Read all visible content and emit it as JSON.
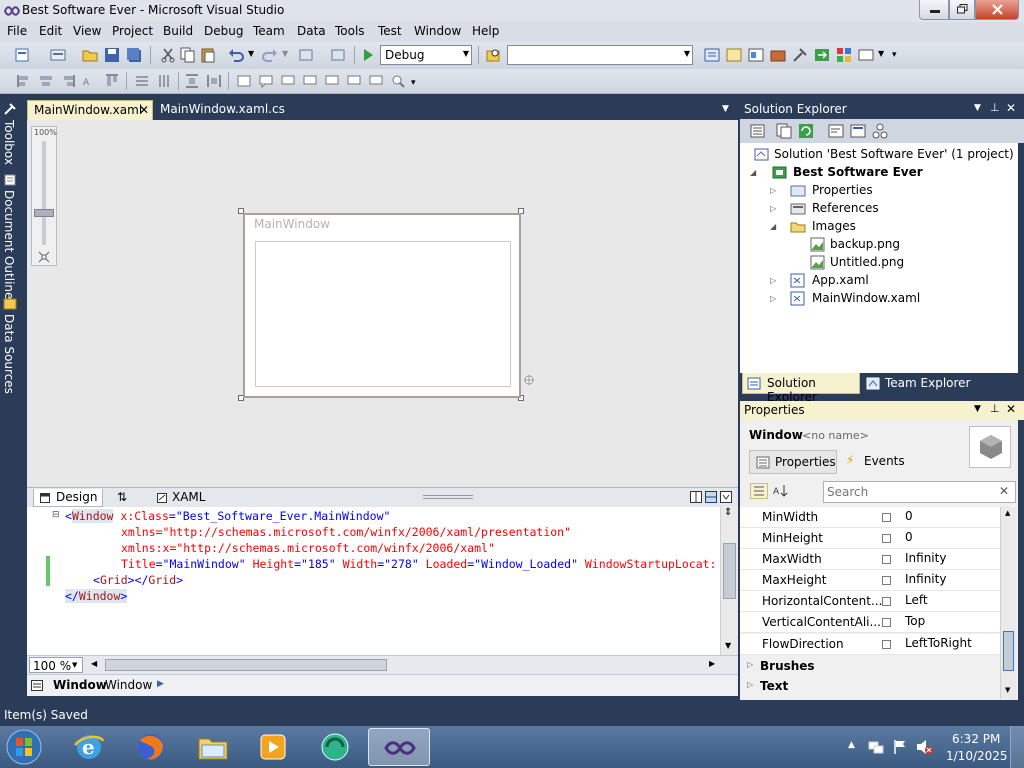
{
  "window": {
    "title": "Best Software Ever - Microsoft Visual Studio"
  },
  "menu": [
    "File",
    "Edit",
    "View",
    "Project",
    "Build",
    "Debug",
    "Team",
    "Data",
    "Tools",
    "Test",
    "Window",
    "Help"
  ],
  "toolbar": {
    "config_value": "Debug",
    "search_combo_value": ""
  },
  "left_tabs": [
    "Toolbox",
    "Document Outline",
    "Data Sources"
  ],
  "doc_tabs": [
    {
      "label": "MainWindow.xaml",
      "active": true
    },
    {
      "label": "MainWindow.xaml.cs",
      "active": false
    }
  ],
  "designer": {
    "zoom_label": "100%",
    "preview_title": "MainWindow"
  },
  "split": {
    "design_label": "Design",
    "xaml_label": "XAML"
  },
  "xaml_code": {
    "line1": [
      "<",
      "Window",
      " x:Class",
      "=\"Best_Software_Ever.MainWindow\""
    ],
    "line2": "xmlns=\"http://schemas.microsoft.com/winfx/2006/xaml/presentation\"",
    "line3": "xmlns:x=\"http://schemas.microsoft.com/winfx/2006/xaml\"",
    "line4": {
      "a1": "Title",
      "v1": "=\"MainWindow\"",
      "a2": " Height",
      "v2": "=\"185\"",
      "a3": " Width",
      "v3": "=\"278\"",
      "a4": " Loaded",
      "v4": "=\"Window_Loaded\"",
      "a5": " WindowStartupLocat:"
    },
    "line5": [
      "<",
      "Grid",
      "></",
      "Grid",
      ">"
    ],
    "line6": [
      "</",
      "Window",
      ">"
    ]
  },
  "editor_footer": {
    "zoom": "100 %",
    "breadcrumb_bold": "Window",
    "breadcrumb": "Window"
  },
  "solution_explorer": {
    "title": "Solution Explorer",
    "items": [
      {
        "label": "Solution 'Best Software Ever' (1 project)",
        "level": 0,
        "bold": false
      },
      {
        "label": "Best Software Ever",
        "level": 1,
        "bold": true
      },
      {
        "label": "Properties",
        "level": 2,
        "bold": false
      },
      {
        "label": "References",
        "level": 2,
        "bold": false
      },
      {
        "label": "Images",
        "level": 2,
        "bold": false
      },
      {
        "label": "backup.png",
        "level": 3,
        "bold": false
      },
      {
        "label": "Untitled.png",
        "level": 3,
        "bold": false
      },
      {
        "label": "App.xaml",
        "level": 2,
        "bold": false
      },
      {
        "label": "MainWindow.xaml",
        "level": 2,
        "bold": false
      }
    ],
    "tabs": [
      "Solution Explorer",
      "Team Explorer"
    ]
  },
  "properties": {
    "title": "Properties",
    "object_type": "Window",
    "object_name": "<no name>",
    "tab_properties": "Properties",
    "tab_events": "Events",
    "search_placeholder": "Search",
    "rows": [
      {
        "name": "MinWidth",
        "value": "0"
      },
      {
        "name": "MinHeight",
        "value": "0"
      },
      {
        "name": "MaxWidth",
        "value": "Infinity"
      },
      {
        "name": "MaxHeight",
        "value": "Infinity"
      },
      {
        "name": "HorizontalContent...",
        "value": "Left"
      },
      {
        "name": "VerticalContentAli...",
        "value": "Top"
      },
      {
        "name": "FlowDirection",
        "value": "LeftToRight"
      }
    ],
    "categories": [
      "Brushes",
      "Text"
    ]
  },
  "status": {
    "text": "Item(s) Saved"
  },
  "taskbar": {
    "time": "6:32 PM",
    "date": "1/10/2025"
  }
}
